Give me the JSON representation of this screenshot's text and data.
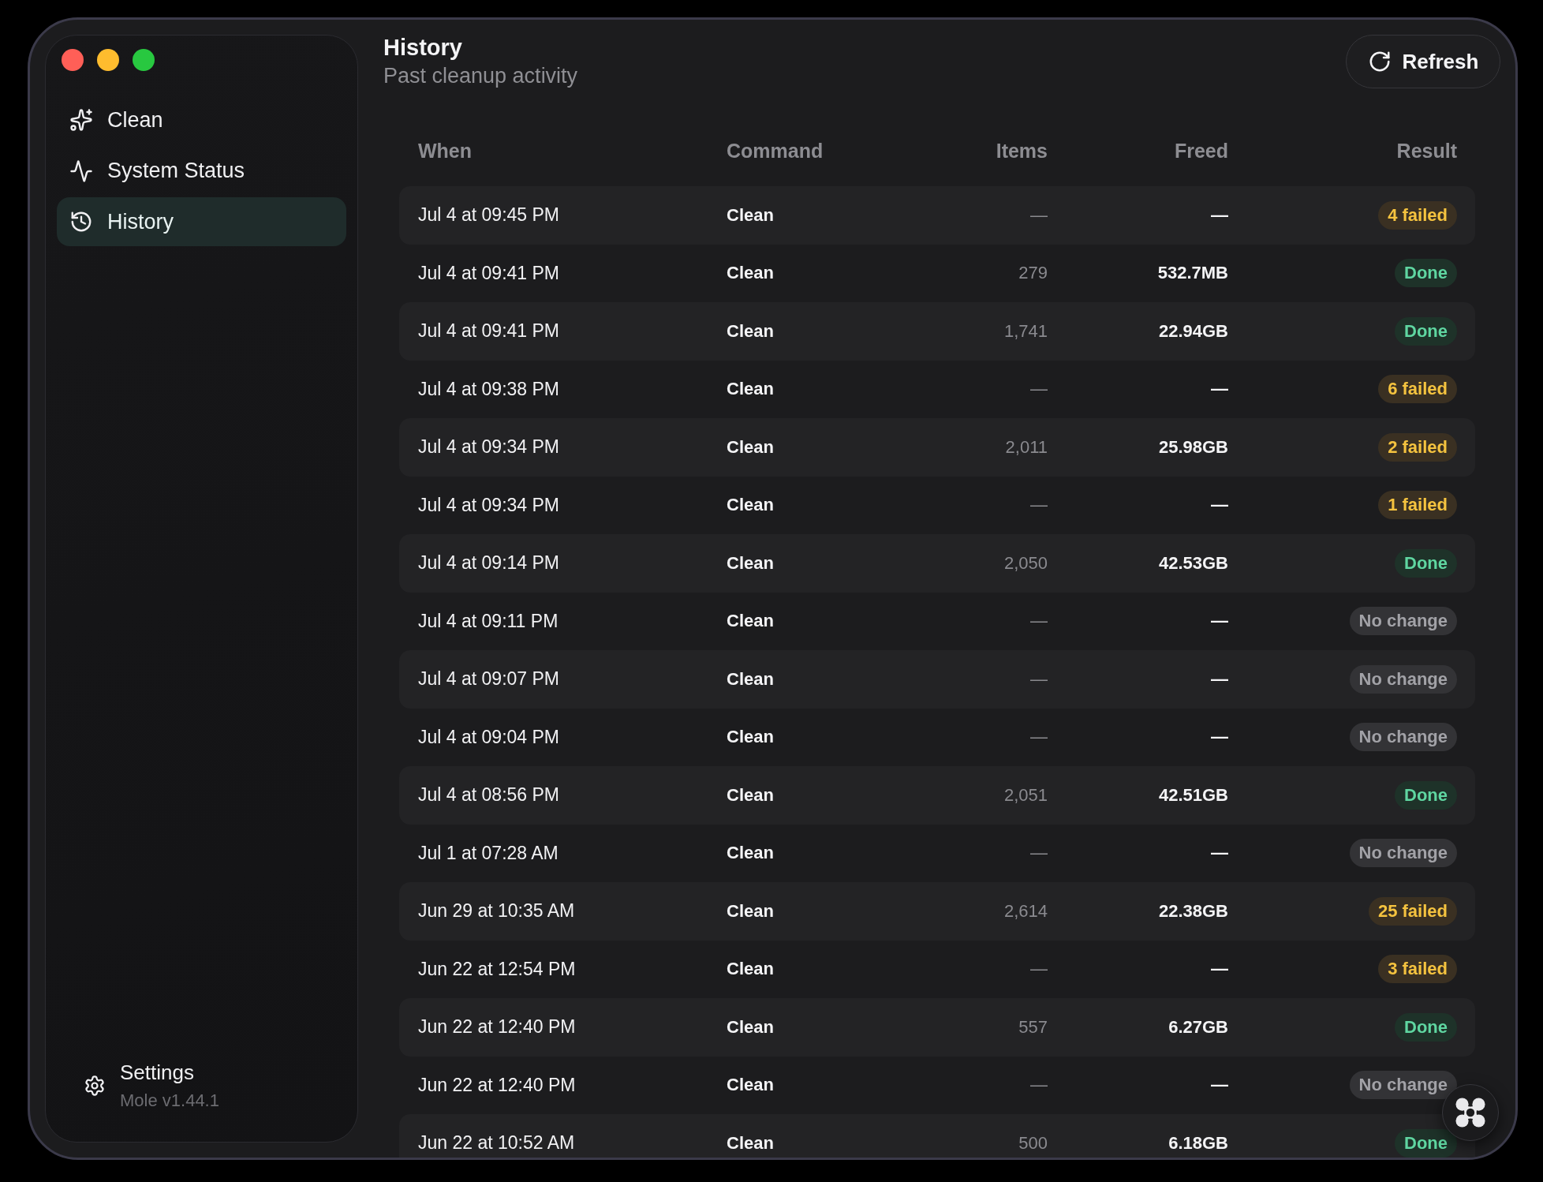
{
  "sidebar": {
    "items": [
      {
        "label": "Clean",
        "selected": false
      },
      {
        "label": "System Status",
        "selected": false
      },
      {
        "label": "History",
        "selected": true
      }
    ],
    "footer": {
      "label": "Settings",
      "version": "Mole v1.44.1"
    }
  },
  "header": {
    "title": "History",
    "subtitle": "Past cleanup activity",
    "refresh_button": "Refresh"
  },
  "table": {
    "columns": [
      "When",
      "Command",
      "Items",
      "Freed",
      "Result"
    ],
    "rows": [
      {
        "when": "Jul 4 at 09:45 PM",
        "command": "Clean",
        "items": "—",
        "freed": "—",
        "result": {
          "label": "4 failed",
          "kind": "failed"
        }
      },
      {
        "when": "Jul 4 at 09:41 PM",
        "command": "Clean",
        "items": "279",
        "freed": "532.7MB",
        "result": {
          "label": "Done",
          "kind": "done"
        }
      },
      {
        "when": "Jul 4 at 09:41 PM",
        "command": "Clean",
        "items": "1,741",
        "freed": "22.94GB",
        "result": {
          "label": "Done",
          "kind": "done"
        }
      },
      {
        "when": "Jul 4 at 09:38 PM",
        "command": "Clean",
        "items": "—",
        "freed": "—",
        "result": {
          "label": "6 failed",
          "kind": "failed"
        }
      },
      {
        "when": "Jul 4 at 09:34 PM",
        "command": "Clean",
        "items": "2,011",
        "freed": "25.98GB",
        "result": {
          "label": "2 failed",
          "kind": "failed"
        }
      },
      {
        "when": "Jul 4 at 09:34 PM",
        "command": "Clean",
        "items": "—",
        "freed": "—",
        "result": {
          "label": "1 failed",
          "kind": "failed"
        }
      },
      {
        "when": "Jul 4 at 09:14 PM",
        "command": "Clean",
        "items": "2,050",
        "freed": "42.53GB",
        "result": {
          "label": "Done",
          "kind": "done"
        }
      },
      {
        "when": "Jul 4 at 09:11 PM",
        "command": "Clean",
        "items": "—",
        "freed": "—",
        "result": {
          "label": "No change",
          "kind": "no_change"
        }
      },
      {
        "when": "Jul 4 at 09:07 PM",
        "command": "Clean",
        "items": "—",
        "freed": "—",
        "result": {
          "label": "No change",
          "kind": "no_change"
        }
      },
      {
        "when": "Jul 4 at 09:04 PM",
        "command": "Clean",
        "items": "—",
        "freed": "—",
        "result": {
          "label": "No change",
          "kind": "no_change"
        }
      },
      {
        "when": "Jul 4 at 08:56 PM",
        "command": "Clean",
        "items": "2,051",
        "freed": "42.51GB",
        "result": {
          "label": "Done",
          "kind": "done"
        }
      },
      {
        "when": "Jul 1 at 07:28 AM",
        "command": "Clean",
        "items": "—",
        "freed": "—",
        "result": {
          "label": "No change",
          "kind": "no_change"
        }
      },
      {
        "when": "Jun 29 at 10:35 AM",
        "command": "Clean",
        "items": "2,614",
        "freed": "22.38GB",
        "result": {
          "label": "25 failed",
          "kind": "failed"
        }
      },
      {
        "when": "Jun 22 at 12:54 PM",
        "command": "Clean",
        "items": "—",
        "freed": "—",
        "result": {
          "label": "3 failed",
          "kind": "failed"
        }
      },
      {
        "when": "Jun 22 at 12:40 PM",
        "command": "Clean",
        "items": "557",
        "freed": "6.27GB",
        "result": {
          "label": "Done",
          "kind": "done"
        }
      },
      {
        "when": "Jun 22 at 12:40 PM",
        "command": "Clean",
        "items": "—",
        "freed": "—",
        "result": {
          "label": "No change",
          "kind": "no_change"
        }
      },
      {
        "when": "Jun 22 at 10:52 AM",
        "command": "Clean",
        "items": "500",
        "freed": "6.18GB",
        "result": {
          "label": "Done",
          "kind": "done"
        }
      }
    ]
  }
}
